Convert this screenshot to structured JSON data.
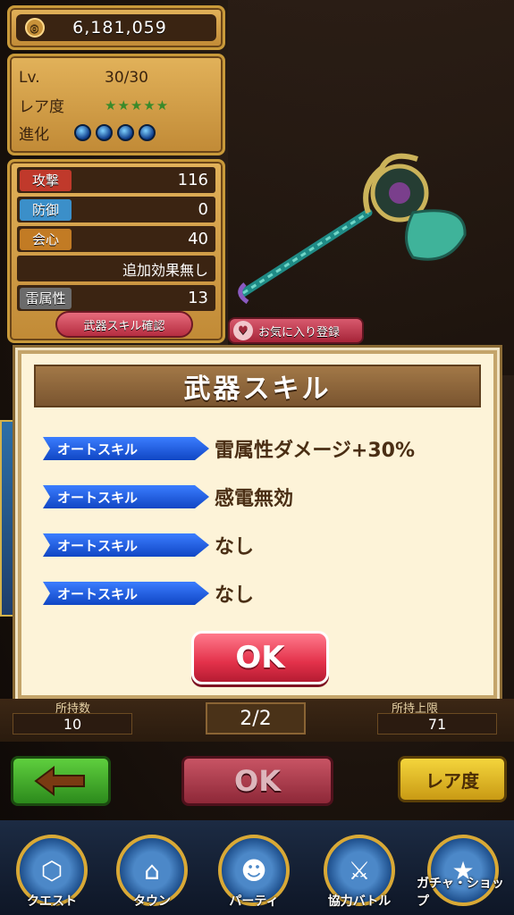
{
  "coins": {
    "value": "6,181,059"
  },
  "status": {
    "level_label": "Lv.",
    "level_value": "30/30",
    "rarity_label": "レア度",
    "rarity_stars": "★★★★★",
    "evolution_label": "進化"
  },
  "stats": {
    "items": [
      {
        "label": "攻撃",
        "value": "116",
        "color": "#c0392b"
      },
      {
        "label": "防御",
        "value": "0",
        "color": "#3b8fc9"
      },
      {
        "label": "会心",
        "value": "40",
        "color": "#c27b24"
      },
      {
        "label": "",
        "value": "追加効果無し",
        "color": ""
      },
      {
        "label": "雷属性",
        "value": "13",
        "color": "#6b6b6b"
      }
    ],
    "skill_check_label": "武器スキル確認"
  },
  "favorite_label": "お気に入り登録",
  "dialog": {
    "title": "武器スキル",
    "skills": [
      {
        "tag": "オートスキル",
        "text": "雷属性ダメージ+30%"
      },
      {
        "tag": "オートスキル",
        "text": "感電無効"
      },
      {
        "tag": "オートスキル",
        "text": "なし"
      },
      {
        "tag": "オートスキル",
        "text": "なし"
      }
    ],
    "ok_label": "OK"
  },
  "inventory": {
    "owned_label": "所持数",
    "owned_value": "10",
    "page": "2/2",
    "limit_label": "所持上限",
    "limit_value": "71"
  },
  "actions": {
    "ok_label": "OK",
    "rarity_label": "レア度"
  },
  "nav": {
    "items": [
      {
        "label": "クエスト",
        "icon": "quest-icon"
      },
      {
        "label": "タウン",
        "icon": "town-icon"
      },
      {
        "label": "パーティ",
        "icon": "party-icon"
      },
      {
        "label": "協力バトル",
        "icon": "coop-battle-icon"
      },
      {
        "label": "ガチャ・ショップ",
        "icon": "gacha-shop-icon"
      }
    ]
  }
}
